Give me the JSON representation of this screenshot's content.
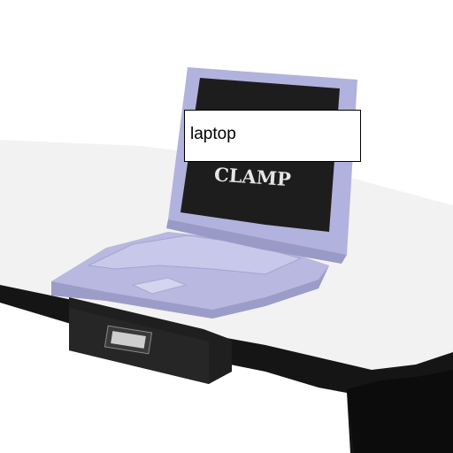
{
  "photo": {
    "screen_text": "CLAMP",
    "label": "laptop"
  },
  "colors": {
    "desk": "#f3f3f3",
    "desk_edge": "#141414",
    "laptop_body": "#b9b9e2",
    "laptop_screen": "#1c1c1c",
    "clamp_box": "#1e1e1e"
  }
}
